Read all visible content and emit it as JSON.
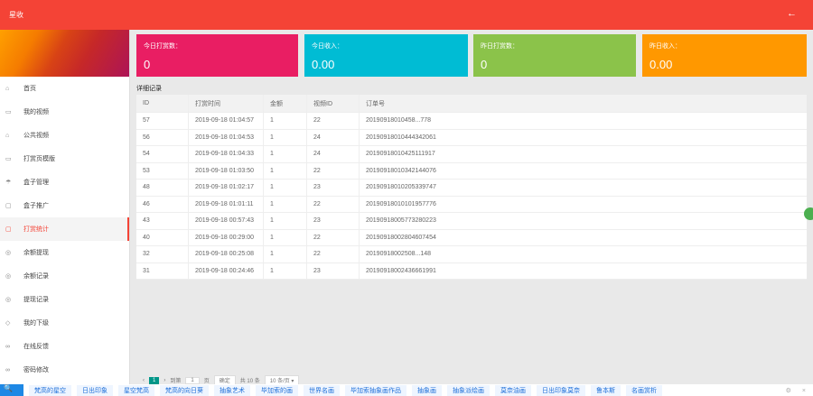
{
  "header": {
    "title": "星收",
    "back_icon": "←"
  },
  "sidebar": {
    "items": [
      {
        "label": "首页",
        "icon": "⌂"
      },
      {
        "label": "我的视频",
        "icon": "▭"
      },
      {
        "label": "公共视频",
        "icon": "⌂"
      },
      {
        "label": "打赏页模版",
        "icon": "▭"
      },
      {
        "label": "盒子管理",
        "icon": "☂"
      },
      {
        "label": "盒子推广",
        "icon": "▢"
      },
      {
        "label": "打赏统计",
        "icon": "▢"
      },
      {
        "label": "余额提现",
        "icon": "◎"
      },
      {
        "label": "余额记录",
        "icon": "◎"
      },
      {
        "label": "提现记录",
        "icon": "◎"
      },
      {
        "label": "我的下级",
        "icon": "◇"
      },
      {
        "label": "在线反馈",
        "icon": "∞"
      },
      {
        "label": "密码修改",
        "icon": "∞"
      }
    ],
    "active": "打赏统计"
  },
  "cards": [
    {
      "label": "今日打赏数：",
      "value": "0",
      "color": "#e91e63"
    },
    {
      "label": "今日收入：",
      "value": "0.00",
      "color": "#00bcd4"
    },
    {
      "label": "昨日打赏数：",
      "value": "0",
      "color": "#8bc34a"
    },
    {
      "label": "昨日收入：",
      "value": "0.00",
      "color": "#ff9800"
    }
  ],
  "section_title": "详细记录",
  "table": {
    "headers": [
      "ID",
      "打赏时间",
      "金额",
      "视频ID",
      "订单号"
    ],
    "rows": [
      [
        "57",
        "2019-09-18 01:04:57",
        "1",
        "22",
        "20190918010458...778"
      ],
      [
        "56",
        "2019-09-18 01:04:53",
        "1",
        "24",
        "20190918010444342061"
      ],
      [
        "54",
        "2019-09-18 01:04:33",
        "1",
        "24",
        "20190918010425111917"
      ],
      [
        "53",
        "2019-09-18 01:03:50",
        "1",
        "22",
        "20190918010342144076"
      ],
      [
        "48",
        "2019-09-18 01:02:17",
        "1",
        "23",
        "20190918010205339747"
      ],
      [
        "46",
        "2019-09-18 01:01:11",
        "1",
        "22",
        "20190918010101957776"
      ],
      [
        "43",
        "2019-09-18 00:57:43",
        "1",
        "23",
        "20190918005773280223"
      ],
      [
        "40",
        "2019-09-18 00:29:00",
        "1",
        "22",
        "20190918002804607454"
      ],
      [
        "32",
        "2019-09-18 00:25:08",
        "1",
        "22",
        "20190918002508...148"
      ],
      [
        "31",
        "2019-09-18 00:24:46",
        "1",
        "23",
        "20190918002436661991"
      ]
    ]
  },
  "pager": {
    "prev": "‹",
    "current": "1",
    "next": "›",
    "goto": "到第",
    "page_input": "1",
    "page_unit": "页",
    "confirm": "确定",
    "total": "共 10 条",
    "per_page": "10 条/页 ▾"
  },
  "bottom": {
    "tags": [
      "梵高的星空",
      "日出印象",
      "星空梵高",
      "梵高的向日葵",
      "抽象艺术",
      "毕加索的画",
      "世界名画",
      "毕加索抽象画作品",
      "抽象画",
      "抽象派绘画",
      "莫奈油画",
      "日出印象莫奈",
      "鲁本斯",
      "名画赏析"
    ],
    "settings": "⚙",
    "close": "×"
  }
}
